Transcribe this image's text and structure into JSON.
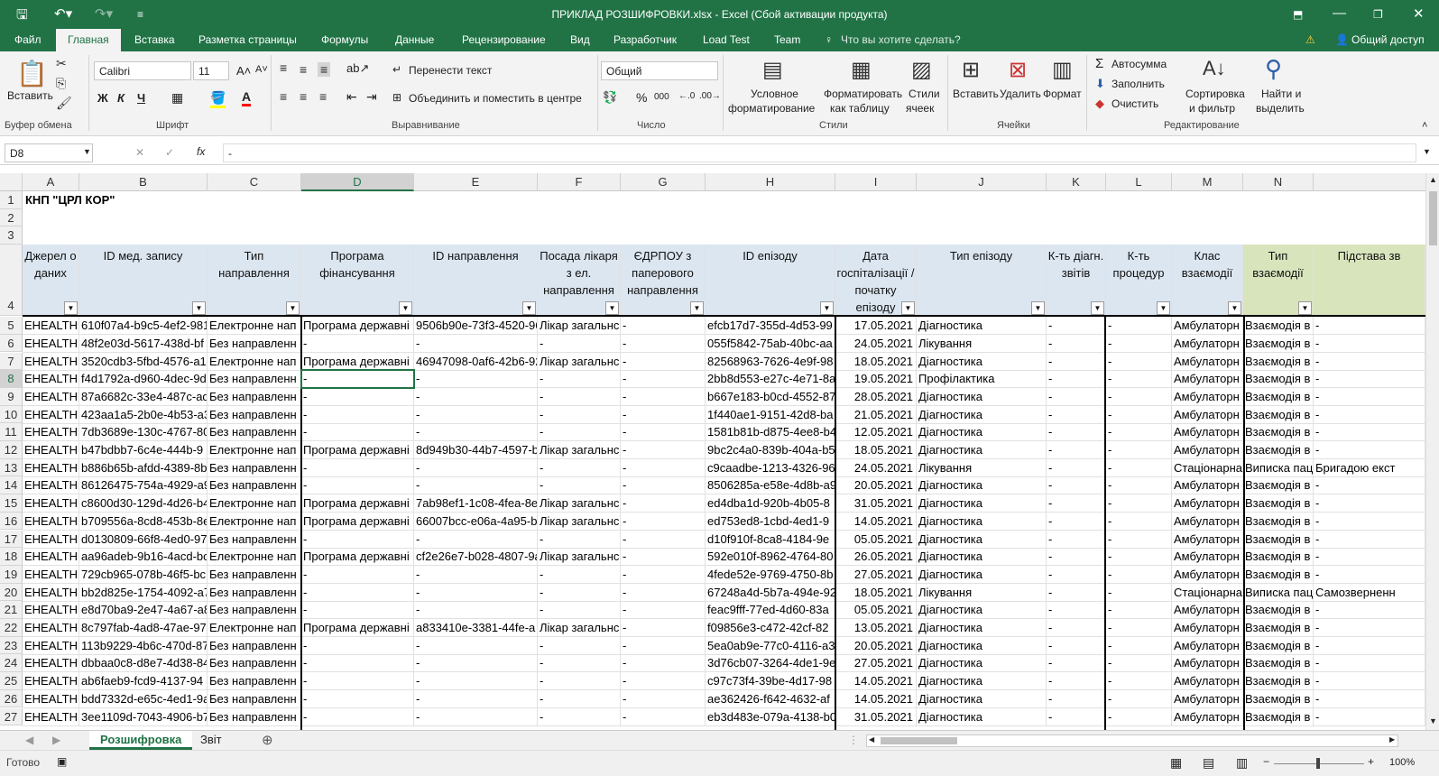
{
  "window": {
    "title": "ПРИКЛАД РОЗШИФРОВКИ.xlsx - Excel (Сбой активации продукта)"
  },
  "tabs": [
    "Файл",
    "Главная",
    "Вставка",
    "Разметка страницы",
    "Формулы",
    "Данные",
    "Рецензирование",
    "Вид",
    "Разработчик",
    "Load Test",
    "Team"
  ],
  "search_hint": "Что вы хотите сделать?",
  "share": "Общий доступ",
  "ribbon": {
    "paste": "Вставить",
    "clipboard": "Буфер обмена",
    "font_name": "Calibri",
    "font_size": "11",
    "bold": "Ж",
    "italic": "К",
    "underline": "Ч",
    "font_group": "Шрифт",
    "wrap": "Перенести текст",
    "merge": "Объединить и поместить в центре",
    "align_group": "Выравнивание",
    "number_format": "Общий",
    "number_group": "Число",
    "cond1": "Условное",
    "cond2": "форматирование",
    "table1": "Форматировать",
    "table2": "как таблицу",
    "styles1": "Стили",
    "styles2": "ячеек",
    "styles_group": "Стили",
    "insert": "Вставить",
    "delete": "Удалить",
    "format": "Формат",
    "cells_group": "Ячейки",
    "autosum": "Автосумма",
    "fill": "Заполнить",
    "clear": "Очистить",
    "sort1": "Сортировка",
    "sort2": "и фильтр",
    "find1": "Найти и",
    "find2": "выделить",
    "editing_group": "Редактирование"
  },
  "formula_bar": {
    "cell_ref": "D8",
    "value": "-"
  },
  "columns": [
    "A",
    "B",
    "C",
    "D",
    "E",
    "F",
    "G",
    "H",
    "I",
    "J",
    "K",
    "L",
    "M",
    "N"
  ],
  "selected_col": "D",
  "selected_row": "8",
  "title_cell": "КНП \"ЦРЛ КОР\"",
  "headers": [
    "Джерел о даних",
    "ID мед. запису",
    "Тип направлення",
    "Програма фінансування",
    "ID направлення",
    "Посада лікаря з ел. направлення",
    "ЄДРПОУ з паперового направлення",
    "ID епізоду",
    "Дата госпіталізації / початку епізоду",
    "Тип епізоду",
    "К-ть діагн. звітів",
    "К-ть процедур",
    "Клас взаємодії",
    "Тип взаємодії",
    "Підстава зв"
  ],
  "rows": [
    [
      "5",
      "EHEALTH",
      "610f07a4-b9c5-4ef2-981",
      "Електронне нап",
      "Програма державні",
      "9506b90e-73f3-4520-96",
      "Лікар загальнс",
      "-",
      "efcb17d7-355d-4d53-99",
      "17.05.2021",
      "Діагностика",
      "-",
      "-",
      "Амбулаторн",
      "Взаємодія в",
      "-"
    ],
    [
      "6",
      "EHEALTH",
      "48f2e03d-5617-438d-bf",
      "Без направленн",
      "-",
      "-",
      "-",
      "-",
      "055f5842-75ab-40bc-aa",
      "24.05.2021",
      "Лікування",
      "-",
      "-",
      "Амбулаторн",
      "Взаємодія в",
      "-"
    ],
    [
      "7",
      "EHEALTH",
      "3520cdb3-5fbd-4576-a1",
      "Електронне нап",
      "Програма державні",
      "46947098-0af6-42b6-92",
      "Лікар загальнс",
      "-",
      "82568963-7626-4e9f-98",
      "18.05.2021",
      "Діагностика",
      "-",
      "-",
      "Амбулаторн",
      "Взаємодія в",
      "-"
    ],
    [
      "8",
      "EHEALTH",
      "f4d1792a-d960-4dec-9d",
      "Без направленн",
      "-",
      "-",
      "-",
      "-",
      "2bb8d553-e27c-4e71-8a",
      "19.05.2021",
      "Профілактика",
      "-",
      "-",
      "Амбулаторн",
      "Взаємодія в",
      "-"
    ],
    [
      "9",
      "EHEALTH",
      "87a6682c-33e4-487c-ad",
      "Без направленн",
      "-",
      "-",
      "-",
      "-",
      "b667e183-b0cd-4552-87",
      "28.05.2021",
      "Діагностика",
      "-",
      "-",
      "Амбулаторн",
      "Взаємодія в",
      "-"
    ],
    [
      "10",
      "EHEALTH",
      "423aa1a5-2b0e-4b53-a3",
      "Без направленн",
      "-",
      "-",
      "-",
      "-",
      "1f440ae1-9151-42d8-ba",
      "21.05.2021",
      "Діагностика",
      "-",
      "-",
      "Амбулаторн",
      "Взаємодія в",
      "-"
    ],
    [
      "11",
      "EHEALTH",
      "7db3689e-130c-4767-80",
      "Без направленн",
      "-",
      "-",
      "-",
      "-",
      "1581b81b-d875-4ee8-b4",
      "12.05.2021",
      "Діагностика",
      "-",
      "-",
      "Амбулаторн",
      "Взаємодія в",
      "-"
    ],
    [
      "12",
      "EHEALTH",
      "b47bdbb7-6c4e-444b-9",
      "Електронне нап",
      "Програма державні",
      "8d949b30-44b7-4597-b",
      "Лікар загальнс",
      "-",
      "9bc2c4a0-839b-404a-b5",
      "18.05.2021",
      "Діагностика",
      "-",
      "-",
      "Амбулаторн",
      "Взаємодія в",
      "-"
    ],
    [
      "13",
      "EHEALTH",
      "b886b65b-afdd-4389-8b",
      "Без направленн",
      "-",
      "-",
      "-",
      "-",
      "c9caadbe-1213-4326-96",
      "24.05.2021",
      "Лікування",
      "-",
      "-",
      "Стаціонарна",
      "Виписка пац",
      "Бригадою екст"
    ],
    [
      "14",
      "EHEALTH",
      "86126475-754a-4929-a9",
      "Без направленн",
      "-",
      "-",
      "-",
      "-",
      "8506285a-e58e-4d8b-a9",
      "20.05.2021",
      "Діагностика",
      "-",
      "-",
      "Амбулаторн",
      "Взаємодія в",
      "-"
    ],
    [
      "15",
      "EHEALTH",
      "c8600d30-129d-4d26-b4",
      "Електронне нап",
      "Програма державні",
      "7ab98ef1-1c08-4fea-8e",
      "Лікар загальнс",
      "-",
      "ed4dba1d-920b-4b05-8",
      "31.05.2021",
      "Діагностика",
      "-",
      "-",
      "Амбулаторн",
      "Взаємодія в",
      "-"
    ],
    [
      "16",
      "EHEALTH",
      "b709556a-8cd8-453b-8e",
      "Електронне нап",
      "Програма державні",
      "66007bcc-e06a-4a95-b",
      "Лікар загальнс",
      "-",
      "ed753ed8-1cbd-4ed1-9",
      "14.05.2021",
      "Діагностика",
      "-",
      "-",
      "Амбулаторн",
      "Взаємодія в",
      "-"
    ],
    [
      "17",
      "EHEALTH",
      "d0130809-66f8-4ed0-97",
      "Без направленн",
      "-",
      "-",
      "-",
      "-",
      "d10f910f-8ca8-4184-9e",
      "05.05.2021",
      "Діагностика",
      "-",
      "-",
      "Амбулаторн",
      "Взаємодія в",
      "-"
    ],
    [
      "18",
      "EHEALTH",
      "aa96adeb-9b16-4acd-bc",
      "Електронне нап",
      "Програма державні",
      "cf2e26e7-b028-4807-9a",
      "Лікар загальнс",
      "-",
      "592e010f-8962-4764-80",
      "26.05.2021",
      "Діагностика",
      "-",
      "-",
      "Амбулаторн",
      "Взаємодія в",
      "-"
    ],
    [
      "19",
      "EHEALTH",
      "729cb965-078b-46f5-bc",
      "Без направленн",
      "-",
      "-",
      "-",
      "-",
      "4fede52e-9769-4750-8b",
      "27.05.2021",
      "Діагностика",
      "-",
      "-",
      "Амбулаторн",
      "Взаємодія в",
      "-"
    ],
    [
      "20",
      "EHEALTH",
      "bb2d825e-1754-4092-a7",
      "Без направленн",
      "-",
      "-",
      "-",
      "-",
      "67248a4d-5b7a-494e-92",
      "18.05.2021",
      "Лікування",
      "-",
      "-",
      "Стаціонарна",
      "Виписка пац",
      "Самозверненн"
    ],
    [
      "21",
      "EHEALTH",
      "e8d70ba9-2e47-4a67-a8",
      "Без направленн",
      "-",
      "-",
      "-",
      "-",
      "feac9fff-77ed-4d60-83a",
      "05.05.2021",
      "Діагностика",
      "-",
      "-",
      "Амбулаторн",
      "Взаємодія в",
      "-"
    ],
    [
      "22",
      "EHEALTH",
      "8c797fab-4ad8-47ae-97",
      "Електронне нап",
      "Програма державні",
      "a833410e-3381-44fe-a",
      "Лікар загальнс",
      "-",
      "f09856e3-c472-42cf-82",
      "13.05.2021",
      "Діагностика",
      "-",
      "-",
      "Амбулаторн",
      "Взаємодія в",
      "-"
    ],
    [
      "23",
      "EHEALTH",
      "113b9229-4b6c-470d-87",
      "Без направленн",
      "-",
      "-",
      "-",
      "-",
      "5ea0ab9e-77c0-4116-a3",
      "20.05.2021",
      "Діагностика",
      "-",
      "-",
      "Амбулаторн",
      "Взаємодія в",
      "-"
    ],
    [
      "24",
      "EHEALTH",
      "dbbaa0c8-d8e7-4d38-84",
      "Без направленн",
      "-",
      "-",
      "-",
      "-",
      "3d76cb07-3264-4de1-9e",
      "27.05.2021",
      "Діагностика",
      "-",
      "-",
      "Амбулаторн",
      "Взаємодія в",
      "-"
    ],
    [
      "25",
      "EHEALTH",
      "ab6faeb9-fcd9-4137-94",
      "Без направленн",
      "-",
      "-",
      "-",
      "-",
      "c97c73f4-39be-4d17-98",
      "14.05.2021",
      "Діагностика",
      "-",
      "-",
      "Амбулаторн",
      "Взаємодія в",
      "-"
    ],
    [
      "26",
      "EHEALTH",
      "bdd7332d-e65c-4ed1-9a",
      "Без направленн",
      "-",
      "-",
      "-",
      "-",
      "ae362426-f642-4632-af",
      "14.05.2021",
      "Діагностика",
      "-",
      "-",
      "Амбулаторн",
      "Взаємодія в",
      "-"
    ],
    [
      "27",
      "EHEALTH",
      "3ee1109d-7043-4906-b7",
      "Без направленн",
      "-",
      "-",
      "-",
      "-",
      "eb3d483e-079a-4138-b0",
      "31.05.2021",
      "Діагностика",
      "-",
      "-",
      "Амбулаторн",
      "Взаємодія в",
      "-"
    ]
  ],
  "sheets": [
    "Розшифровка",
    "Звіт"
  ],
  "status": "Готово",
  "zoom": "100%"
}
